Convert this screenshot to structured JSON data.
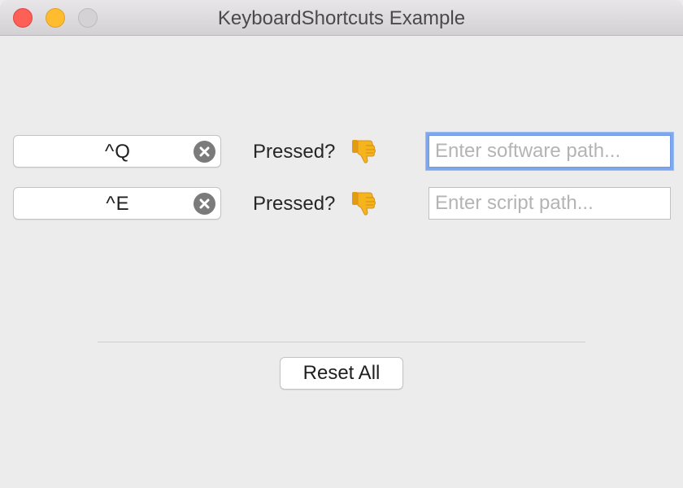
{
  "window": {
    "title": "KeyboardShortcuts Example"
  },
  "shortcuts": [
    {
      "key": "^Q",
      "pressed_label": "Pressed?",
      "pressed_icon": "thumbs-down-icon",
      "path_value": "",
      "path_placeholder": "Enter software path...",
      "focused": true
    },
    {
      "key": "^E",
      "pressed_label": "Pressed?",
      "pressed_icon": "thumbs-down-icon",
      "path_value": "",
      "path_placeholder": "Enter script path...",
      "focused": false
    }
  ],
  "footer": {
    "reset_label": "Reset All"
  },
  "colors": {
    "close": "#fe5f57",
    "minimize": "#febc2e",
    "zoom": "#d4d2d4",
    "focus_ring": "#7fa8ec",
    "thumb": "#f5b31c"
  }
}
